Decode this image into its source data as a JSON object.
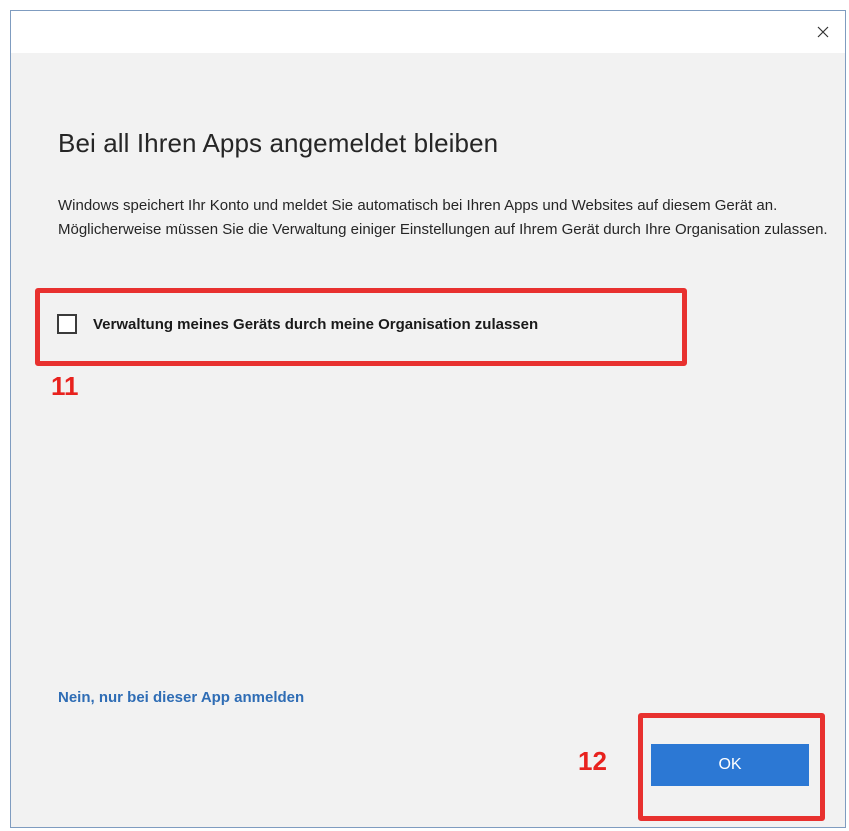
{
  "dialog": {
    "heading": "Bei all Ihren Apps angemeldet bleiben",
    "description": "Windows speichert Ihr Konto und meldet Sie automatisch bei Ihren Apps und Websites auf diesem Gerät an. Möglicherweise müssen Sie die Verwaltung einiger Einstellungen auf Ihrem Gerät durch Ihre Organisation zulassen.",
    "checkbox_label": "Verwaltung meines Geräts durch meine Organisation zulassen",
    "checkbox_checked": false,
    "link_text": "Nein, nur bei dieser App anmelden",
    "ok_label": "OK",
    "close_icon": "close-icon"
  },
  "annotations": {
    "step_checkbox": "11",
    "step_ok": "12",
    "highlight_color": "#e8312f"
  },
  "colors": {
    "accent": "#2c78d4",
    "link": "#2f6db5",
    "background": "#f2f2f2"
  }
}
